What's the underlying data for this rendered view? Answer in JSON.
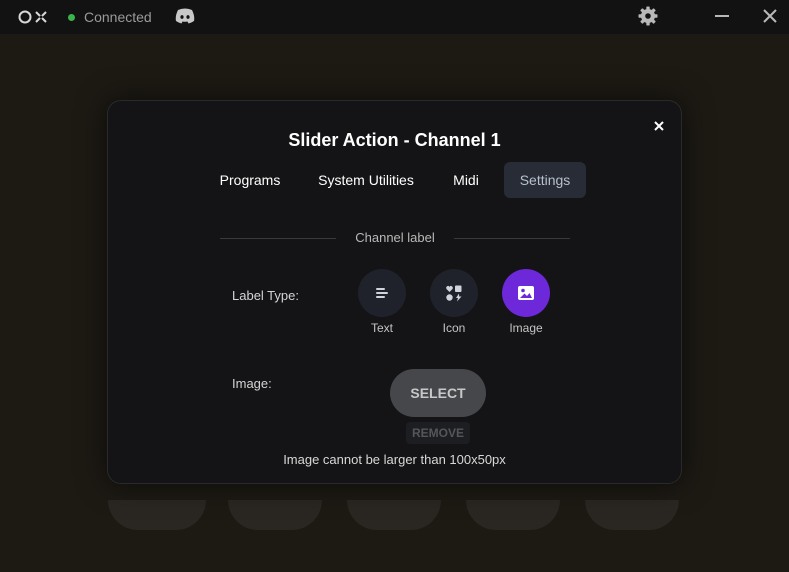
{
  "titlebar": {
    "status": "Connected",
    "status_color": "#3bb34a",
    "icons": [
      "app-logo",
      "discord-icon",
      "gear-icon",
      "minimize-icon",
      "close-icon"
    ]
  },
  "modal": {
    "title": "Slider Action - Channel 1",
    "tabs": [
      {
        "label": "Programs",
        "active": false
      },
      {
        "label": "System Utilities",
        "active": false
      },
      {
        "label": "Midi",
        "active": false
      },
      {
        "label": "Settings",
        "active": true
      }
    ],
    "section_label": "Channel label",
    "label_type_label": "Label Type:",
    "label_types": [
      {
        "label": "Text",
        "icon": "align-left-icon",
        "active": false
      },
      {
        "label": "Icon",
        "icon": "shapes-icon",
        "active": false
      },
      {
        "label": "Image",
        "icon": "image-icon",
        "active": true
      }
    ],
    "image_label": "Image:",
    "select_button": "SELECT",
    "remove_button": "REMOVE",
    "hint": "Image cannot be larger than 100x50px",
    "accent_color": "#6d28d9"
  }
}
